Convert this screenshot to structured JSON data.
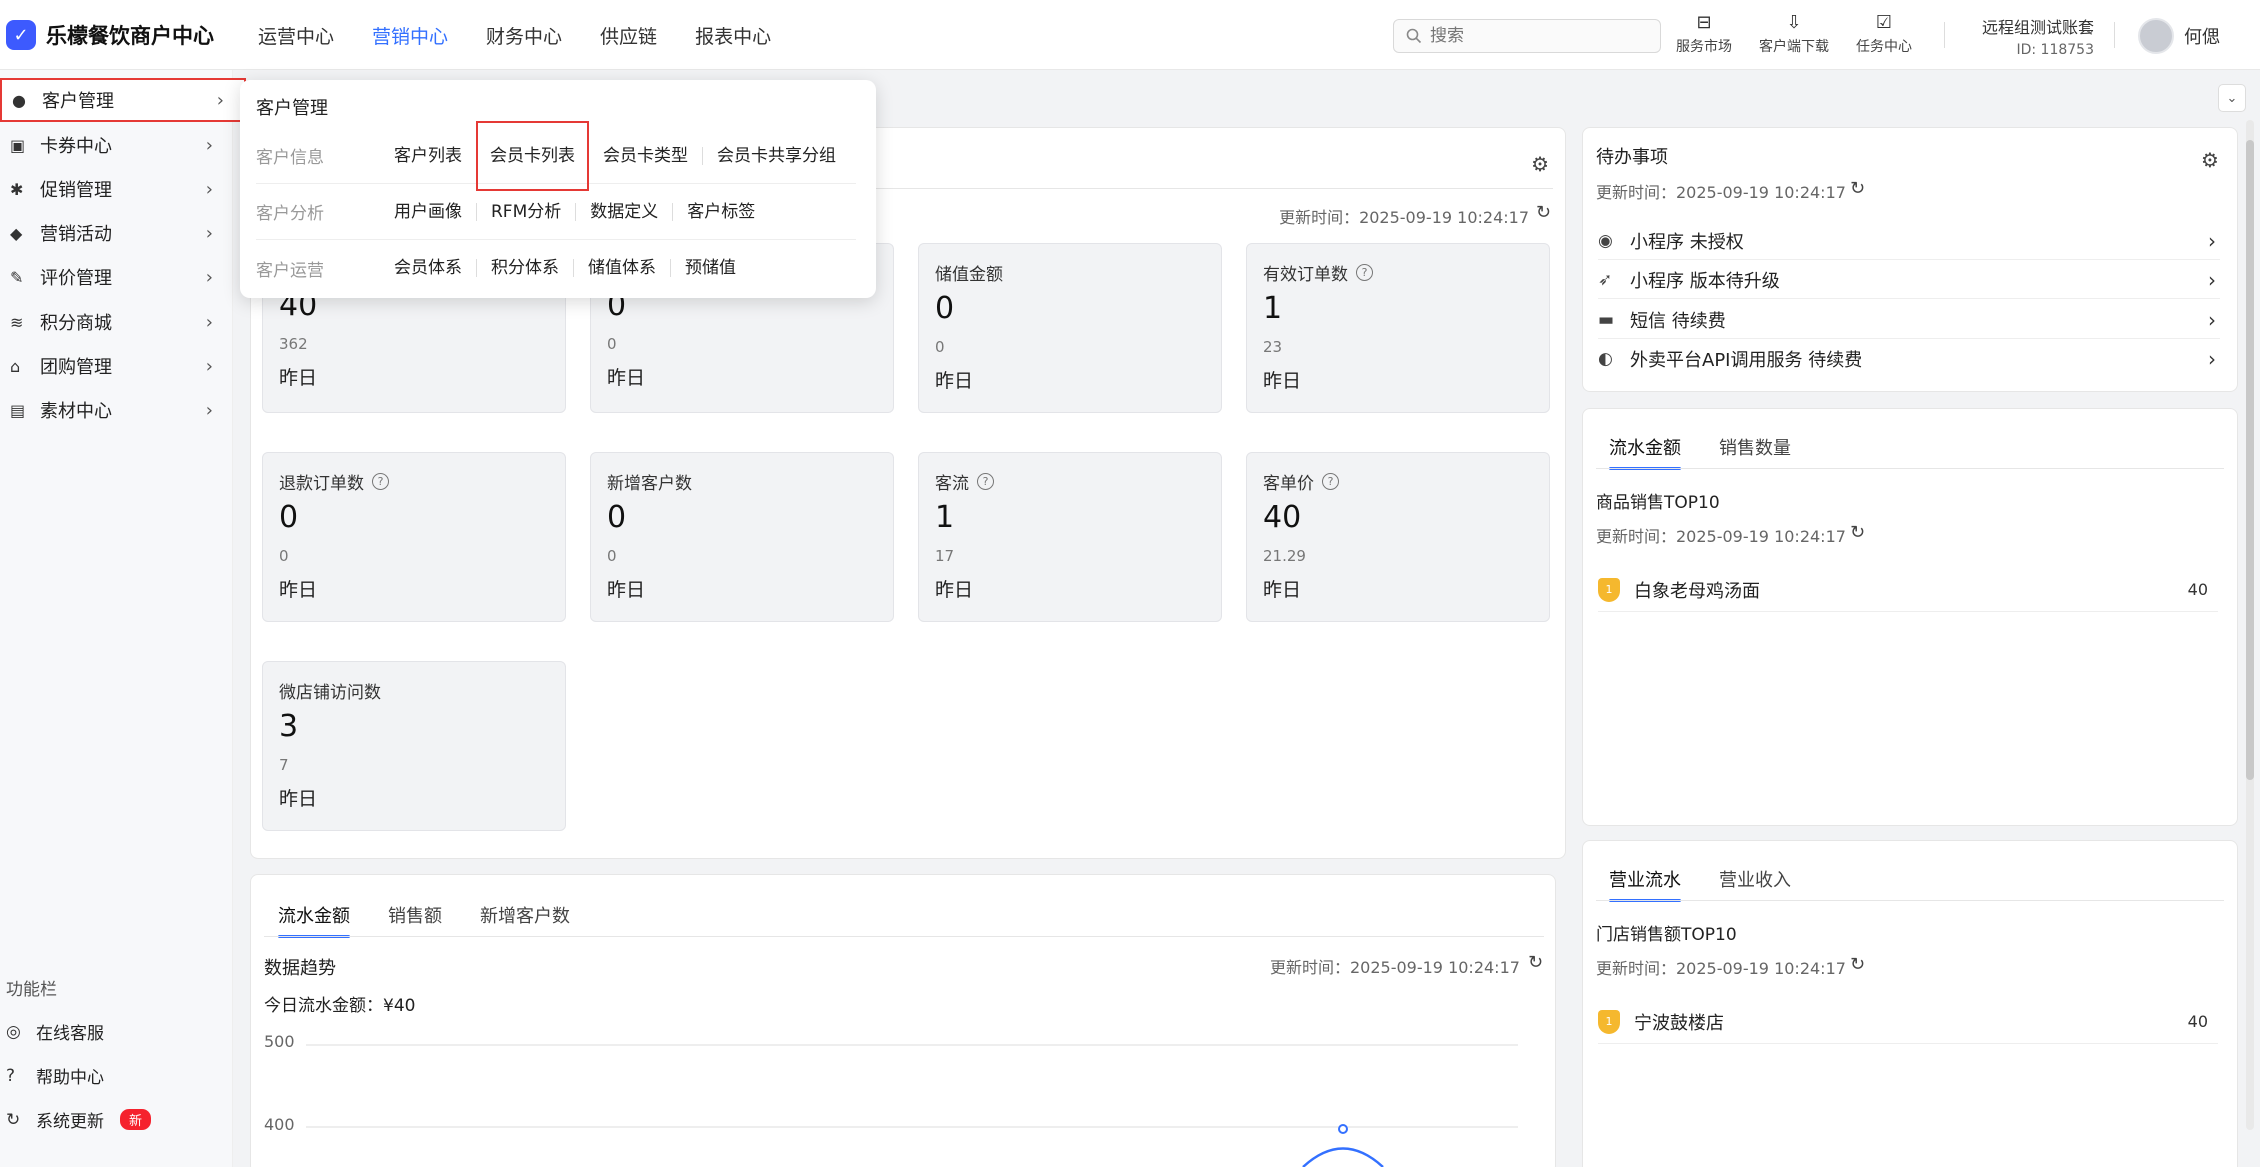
{
  "app": {
    "logo_mark": "✓",
    "title": "乐檬餐饮商户中心"
  },
  "topnav": [
    {
      "label": "运营中心",
      "active": false
    },
    {
      "label": "营销中心",
      "active": true
    },
    {
      "label": "财务中心",
      "active": false
    },
    {
      "label": "供应链",
      "active": false
    },
    {
      "label": "报表中心",
      "active": false
    }
  ],
  "search": {
    "placeholder": "搜索"
  },
  "tools": [
    {
      "icon": "shop-icon",
      "label": "服务市场"
    },
    {
      "icon": "cloud-download-icon",
      "label": "客户端下载"
    },
    {
      "icon": "clipboard-icon",
      "label": "任务中心"
    }
  ],
  "account": {
    "name": "远程组测试账套",
    "id": "ID: 118753"
  },
  "user": {
    "name": "何偲"
  },
  "sidebar": {
    "items": [
      {
        "icon": "user-icon",
        "label": "客户管理",
        "active": true
      },
      {
        "icon": "coupon-icon",
        "label": "卡券中心"
      },
      {
        "icon": "promo-icon",
        "label": "促销管理"
      },
      {
        "icon": "tag-icon",
        "label": "营销活动"
      },
      {
        "icon": "review-icon",
        "label": "评价管理"
      },
      {
        "icon": "points-icon",
        "label": "积分商城"
      },
      {
        "icon": "group-icon",
        "label": "团购管理"
      },
      {
        "icon": "media-icon",
        "label": "素材中心"
      }
    ],
    "footer_title": "功能栏",
    "footer": [
      {
        "icon": "support-icon",
        "label": "在线客服"
      },
      {
        "icon": "help-icon",
        "label": "帮助中心"
      },
      {
        "icon": "refresh-icon",
        "label": "系统更新",
        "badge": "新"
      }
    ]
  },
  "popup": {
    "title": "客户管理",
    "rows": [
      {
        "category": "客户信息",
        "links": [
          "客户列表",
          "会员卡列表",
          "会员卡类型",
          "会员卡共享分组"
        ]
      },
      {
        "category": "客户分析",
        "links": [
          "用户画像",
          "RFM分析",
          "数据定义",
          "客户标签"
        ]
      },
      {
        "category": "客户运营",
        "links": [
          "会员体系",
          "积分体系",
          "储值体系",
          "预储值"
        ]
      }
    ]
  },
  "overview": {
    "update_time": "更新时间：2025-09-19 10:24:17",
    "stats": [
      {
        "title": "",
        "value": "40",
        "prev": "362",
        "label": "昨日",
        "help": false
      },
      {
        "title": "",
        "value": "0",
        "prev": "0",
        "label": "昨日",
        "help": false
      },
      {
        "title": "储值金额",
        "value": "0",
        "prev": "0",
        "label": "昨日",
        "help": false
      },
      {
        "title": "有效订单数",
        "value": "1",
        "prev": "23",
        "label": "昨日",
        "help": true
      },
      {
        "title": "退款订单数",
        "value": "0",
        "prev": "0",
        "label": "昨日",
        "help": true
      },
      {
        "title": "新增客户数",
        "value": "0",
        "prev": "0",
        "label": "昨日",
        "help": false
      },
      {
        "title": "客流",
        "value": "1",
        "prev": "17",
        "label": "昨日",
        "help": true
      },
      {
        "title": "客单价",
        "value": "40",
        "prev": "21.29",
        "label": "昨日",
        "help": true
      },
      {
        "title": "微店铺访问数",
        "value": "3",
        "prev": "7",
        "label": "昨日",
        "help": false
      }
    ]
  },
  "trend": {
    "tabs": [
      "流水金额",
      "销售额",
      "新增客户数"
    ],
    "title": "数据趋势",
    "update_time": "更新时间：2025-09-19 10:24:17",
    "today": "今日流水金额：¥40"
  },
  "chart_data": {
    "type": "line",
    "title": "数据趋势",
    "y_ticks": [
      "500",
      "400"
    ],
    "ylim": [
      0,
      500
    ]
  },
  "todo": {
    "title": "待办事项",
    "update_time": "更新时间：2025-09-19 10:24:17",
    "items": [
      {
        "icon": "miniapp-icon",
        "label": "小程序 未授权"
      },
      {
        "icon": "rocket-icon",
        "label": "小程序 版本待升级"
      },
      {
        "icon": "sms-icon",
        "label": "短信 待续费"
      },
      {
        "icon": "api-icon",
        "label": "外卖平台API调用服务 待续费"
      }
    ]
  },
  "goods_top": {
    "tabs": [
      "流水金额",
      "销售数量"
    ],
    "title": "商品销售TOP10",
    "update_time": "更新时间：2025-09-19 10:24:17",
    "rows": [
      {
        "name": "白象老母鸡汤面",
        "value": "40"
      }
    ]
  },
  "store_top": {
    "tabs": [
      "营业流水",
      "营业收入"
    ],
    "title": "门店销售额TOP10",
    "update_time": "更新时间：2025-09-19 10:24:17",
    "rows": [
      {
        "name": "宁波鼓楼店",
        "value": "40"
      }
    ]
  },
  "colors": {
    "accent": "#3370ff",
    "highlight": "#e53935",
    "brand": "#3d5afe"
  }
}
